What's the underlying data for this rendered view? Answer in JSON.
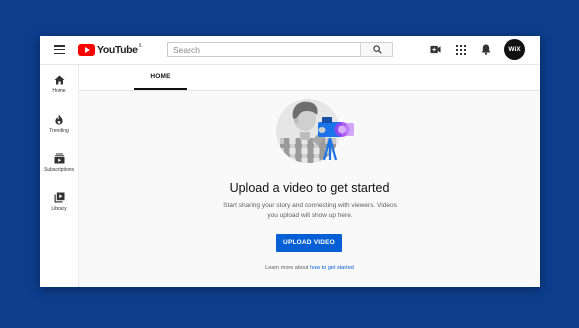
{
  "colors": {
    "page_background": "#0d3d8c",
    "accent": "#065fd4",
    "brand_red": "#ff0000"
  },
  "header": {
    "menu_icon": "hamburger-icon",
    "logo_text": "YouTube",
    "logo_superscript": "IL",
    "search": {
      "placeholder": "Search"
    },
    "icons": [
      "search-icon",
      "create-video-icon",
      "apps-grid-icon",
      "notifications-bell-icon"
    ],
    "avatar_text": "WiX"
  },
  "sidebar": {
    "items": [
      {
        "label": "Home",
        "icon": "home-icon"
      },
      {
        "label": "Trending",
        "icon": "flame-icon"
      },
      {
        "label": "Subscriptions",
        "icon": "subscriptions-icon"
      },
      {
        "label": "Library",
        "icon": "library-icon"
      }
    ]
  },
  "tabs": [
    {
      "label": "HOME",
      "active": true
    }
  ],
  "main": {
    "illustration": "person-with-video-camera-illustration",
    "headline": "Upload a video to get started",
    "subtext": "Start sharing your story and connecting with viewers. Videos you upload will show up here.",
    "upload_button": "UPLOAD VIDEO",
    "learn_more_prefix": "Learn more about",
    "learn_more_link": "how to get started"
  }
}
